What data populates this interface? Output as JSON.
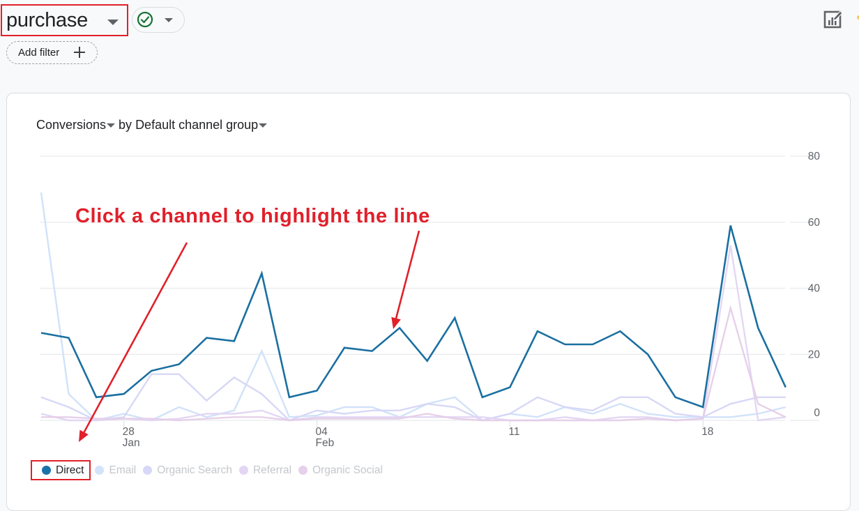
{
  "header": {
    "event_name": "purchase",
    "status_icon": "check-circle-icon",
    "add_filter_label": "Add filter",
    "edit_icon": "edit-chart-icon"
  },
  "card": {
    "metric_label": "Conversions",
    "by_label": "by",
    "dimension_label": "Default channel group"
  },
  "annotation": {
    "text": "Click a channel to highlight the line",
    "color": "#e0202a"
  },
  "chart_data": {
    "type": "line",
    "title": "Conversions by Default channel group",
    "xlabel": "",
    "ylabel": "",
    "y_axis_position": "right",
    "ylim": [
      0,
      80
    ],
    "y_ticks": [
      0,
      20,
      40,
      60,
      80
    ],
    "grid": true,
    "x": [
      "Jan 25",
      "Jan 26",
      "Jan 27",
      "Jan 28",
      "Jan 29",
      "Jan 30",
      "Jan 31",
      "Feb 01",
      "Feb 02",
      "Feb 03",
      "Feb 04",
      "Feb 05",
      "Feb 06",
      "Feb 07",
      "Feb 08",
      "Feb 09",
      "Feb 10",
      "Feb 11",
      "Feb 12",
      "Feb 13",
      "Feb 14",
      "Feb 15",
      "Feb 16",
      "Feb 17",
      "Feb 18",
      "Feb 19",
      "Feb 20",
      "Feb 21"
    ],
    "x_tick_labels": [
      {
        "index": 3,
        "line1": "28",
        "line2": "Jan"
      },
      {
        "index": 10,
        "line1": "04",
        "line2": "Feb"
      },
      {
        "index": 17,
        "line1": "11",
        "line2": ""
      },
      {
        "index": 24,
        "line1": "18",
        "line2": ""
      }
    ],
    "legend_position": "bottom-left",
    "highlighted_series": "Direct",
    "series": [
      {
        "name": "Direct",
        "color": "#1a6fa0",
        "legend_color": "#1a73a8",
        "values": [
          26.5,
          25,
          7,
          8,
          15,
          17,
          25,
          24,
          44.5,
          7,
          9,
          22,
          21,
          28,
          18,
          31,
          7,
          10,
          27,
          23,
          23,
          27,
          20,
          7,
          4,
          59,
          28,
          10
        ]
      },
      {
        "name": "Email",
        "color": "#cfe0f9",
        "legend_color": "#d3e3fa",
        "values": [
          69,
          8,
          0,
          2,
          0,
          4,
          1,
          3,
          21,
          1,
          1.5,
          4,
          4,
          1,
          5,
          7,
          0,
          2,
          1,
          4,
          2,
          5,
          2,
          1,
          1,
          1,
          2,
          4
        ]
      },
      {
        "name": "Organic Search",
        "color": "#d5d6f6",
        "legend_color": "#d7d8f7",
        "values": [
          7,
          4,
          0,
          1,
          14,
          14,
          6,
          13,
          8,
          0,
          3,
          2,
          3,
          3,
          5,
          4,
          0,
          2,
          7,
          4,
          3,
          7,
          7,
          2,
          1,
          5,
          7,
          7
        ]
      },
      {
        "name": "Referral",
        "color": "#e2d5f3",
        "legend_color": "#e3d6f4",
        "values": [
          2,
          0,
          0,
          0.5,
          0,
          0.5,
          2,
          2,
          3,
          0,
          1,
          1,
          1,
          1,
          1,
          1,
          1,
          0,
          0,
          1,
          0,
          1,
          1,
          0,
          0.5,
          53,
          0,
          1
        ]
      },
      {
        "name": "Organic Social",
        "color": "#e5cde8",
        "legend_color": "#e6d0ea",
        "values": [
          1,
          1,
          0.5,
          0.5,
          0.5,
          0,
          0.5,
          1,
          1,
          0,
          0.5,
          0.5,
          0.5,
          0.5,
          2,
          0.5,
          0,
          0,
          0,
          0,
          0,
          0,
          0.5,
          0,
          0.5,
          34,
          5,
          1
        ]
      }
    ]
  }
}
